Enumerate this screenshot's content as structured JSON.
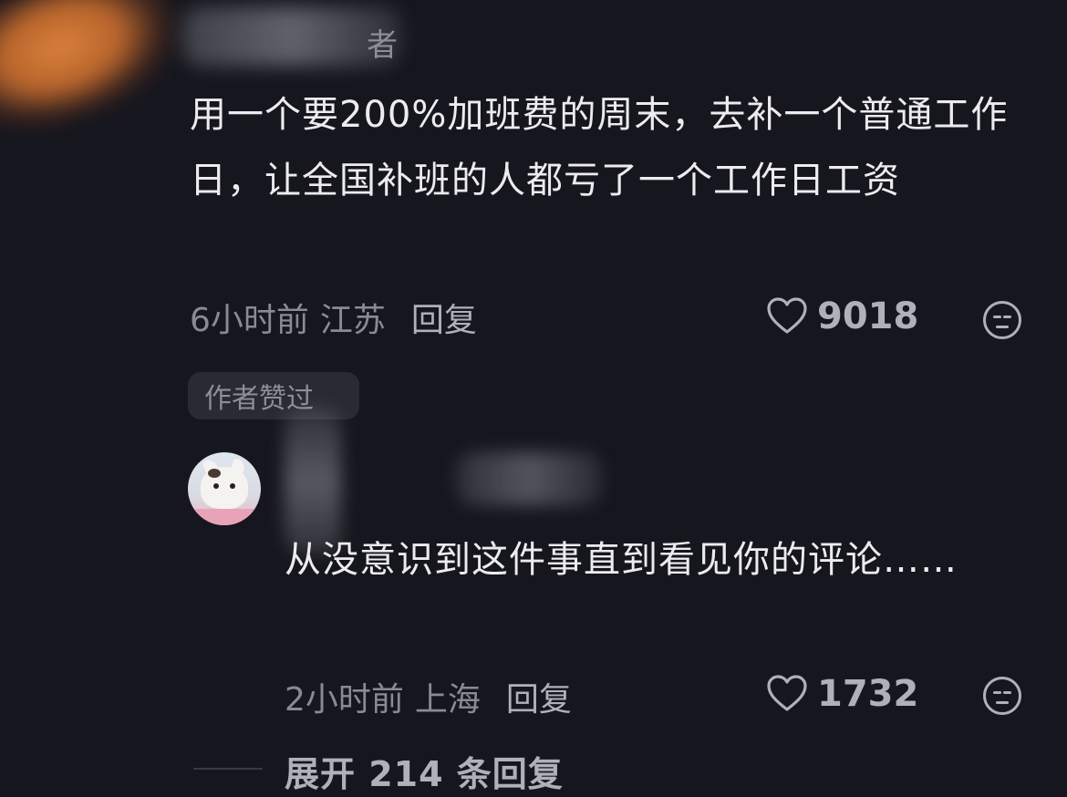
{
  "comment_top": {
    "author_suffix": "者",
    "text": "用一个要200%加班费的周末，去补一个普通工作日，让全国补班的人都亏了一个工作日工资",
    "time": "6小时前",
    "location": "江苏",
    "reply_label": "回复",
    "likes": "9018",
    "badge": "作者赞过"
  },
  "reply_comment": {
    "avatar_icon": "cat-avatar",
    "text": "从没意识到这件事直到看见你的评论……",
    "time": "2小时前",
    "location": "上海",
    "reply_label": "回复",
    "likes": "1732"
  },
  "expand": {
    "label": "展开 214 条回复"
  },
  "colors": {
    "background": "#16161e",
    "text_primary": "#ececf0",
    "text_secondary": "#8a8a93"
  }
}
